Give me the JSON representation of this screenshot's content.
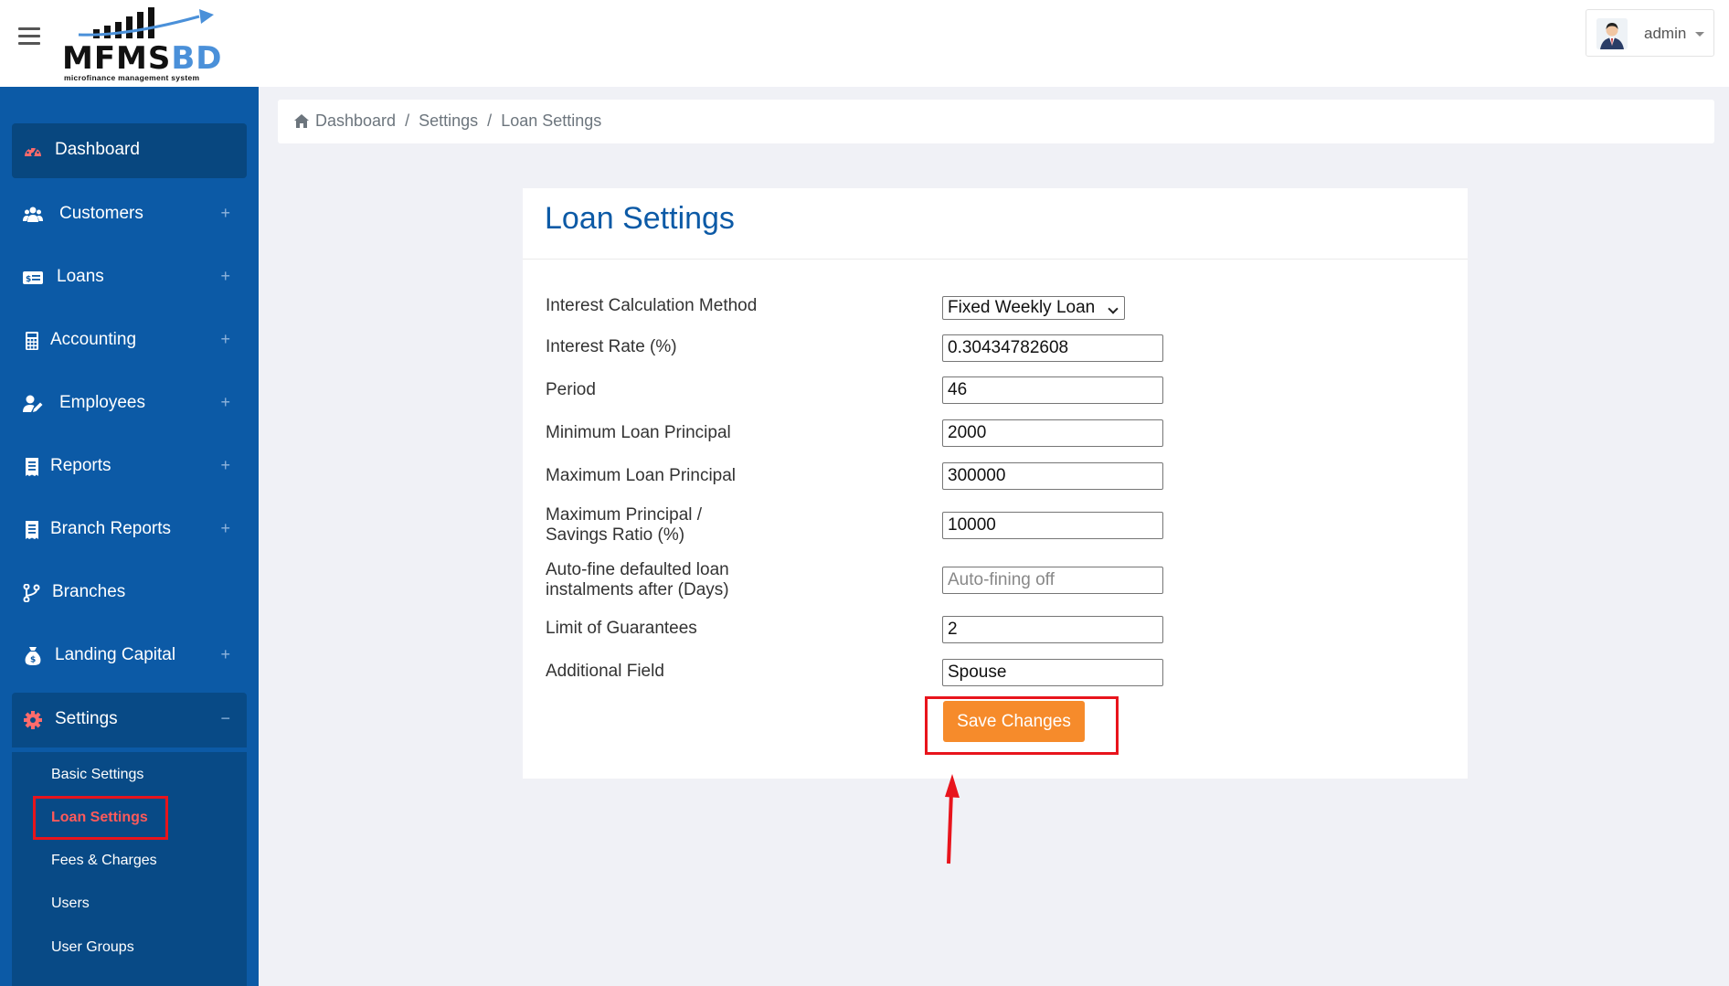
{
  "header": {
    "logo_main": "MFMS",
    "logo_accent": "BD",
    "logo_tagline": "microfinance management system",
    "user_name": "admin"
  },
  "sidebar": {
    "items": [
      {
        "label": "Dashboard",
        "icon": "tachometer-icon",
        "expandable": false
      },
      {
        "label": "Customers",
        "icon": "users-icon",
        "expandable": true,
        "toggle": "+"
      },
      {
        "label": "Loans",
        "icon": "money-bill-icon",
        "expandable": true,
        "toggle": "+"
      },
      {
        "label": "Accounting",
        "icon": "calculator-icon",
        "expandable": true,
        "toggle": "+"
      },
      {
        "label": "Employees",
        "icon": "user-edit-icon",
        "expandable": true,
        "toggle": "+"
      },
      {
        "label": "Reports",
        "icon": "receipt-icon",
        "expandable": true,
        "toggle": "+"
      },
      {
        "label": "Branch Reports",
        "icon": "receipt-icon",
        "expandable": true,
        "toggle": "+"
      },
      {
        "label": "Branches",
        "icon": "code-branch-icon",
        "expandable": false
      },
      {
        "label": "Landing Capital",
        "icon": "money-bag-icon",
        "expandable": true,
        "toggle": "+"
      },
      {
        "label": "Settings",
        "icon": "gear-icon",
        "expandable": true,
        "toggle": "−"
      }
    ],
    "settings_submenu": [
      {
        "label": "Basic Settings"
      },
      {
        "label": "Loan Settings",
        "current": true
      },
      {
        "label": "Fees & Charges"
      },
      {
        "label": "Users"
      },
      {
        "label": "User Groups"
      }
    ]
  },
  "breadcrumb": {
    "items": [
      "Dashboard",
      "Settings",
      "Loan Settings"
    ],
    "separator": "/"
  },
  "form": {
    "title": "Loan Settings",
    "fields": [
      {
        "label": "Interest Calculation Method",
        "type": "select",
        "value": "Fixed Weekly Loan"
      },
      {
        "label": "Interest Rate (%)",
        "value": "0.30434782608"
      },
      {
        "label": "Period",
        "value": "46"
      },
      {
        "label": "Minimum Loan Principal",
        "value": "2000"
      },
      {
        "label": "Maximum Loan Principal",
        "value": "300000"
      },
      {
        "label_line1": "Maximum Principal /",
        "label_line2": "Savings Ratio (%)",
        "value": "10000"
      },
      {
        "label_line1": "Auto-fine defaulted loan",
        "label_line2": "instalments after (Days)",
        "value": "",
        "placeholder": "Auto-fining off"
      },
      {
        "label": "Limit of Guarantees",
        "value": "2"
      },
      {
        "label": "Additional Field",
        "value": "Spouse"
      }
    ],
    "save_label": "Save Changes"
  },
  "colors": {
    "sidebar_bg": "#0c5aa6",
    "title_blue": "#0c5aa6",
    "save_button": "#f68b2b",
    "annotation_red": "#e8141c",
    "current_submenu": "#ff5a5a"
  }
}
